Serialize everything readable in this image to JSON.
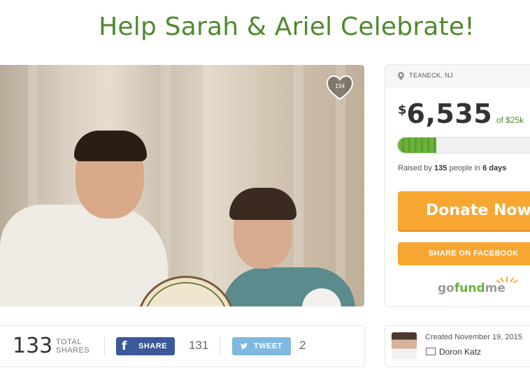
{
  "campaign": {
    "title": "Help Sarah & Ariel Celebrate!",
    "likes": "134"
  },
  "location": "TEANECK, NJ",
  "funding": {
    "currency": "$",
    "amount": "6,535",
    "goal": "of $25k",
    "progress_fraction": 0.26,
    "raised_prefix": "Raised by ",
    "people": "135",
    "people_suffix": " people in ",
    "days": "6 days"
  },
  "actions": {
    "donate_label": "Donate Now",
    "facebook_label": "SHARE ON FACEBOOK"
  },
  "brand": {
    "go": "go",
    "fund": "fund",
    "me": "me"
  },
  "shares": {
    "total": "133",
    "total_label_1": "TOTAL",
    "total_label_2": "SHARES",
    "fb_label": "SHARE",
    "fb_count": "131",
    "tweet_label": "TWEET",
    "tweet_count": "2"
  },
  "organizer": {
    "created": "Created November 19, 2015",
    "name": "Doron Katz"
  },
  "colors": {
    "accent_green": "#4f8a2e",
    "donate_orange": "#f7a632",
    "facebook_blue": "#3b5998",
    "twitter_blue": "#7fb9df"
  }
}
